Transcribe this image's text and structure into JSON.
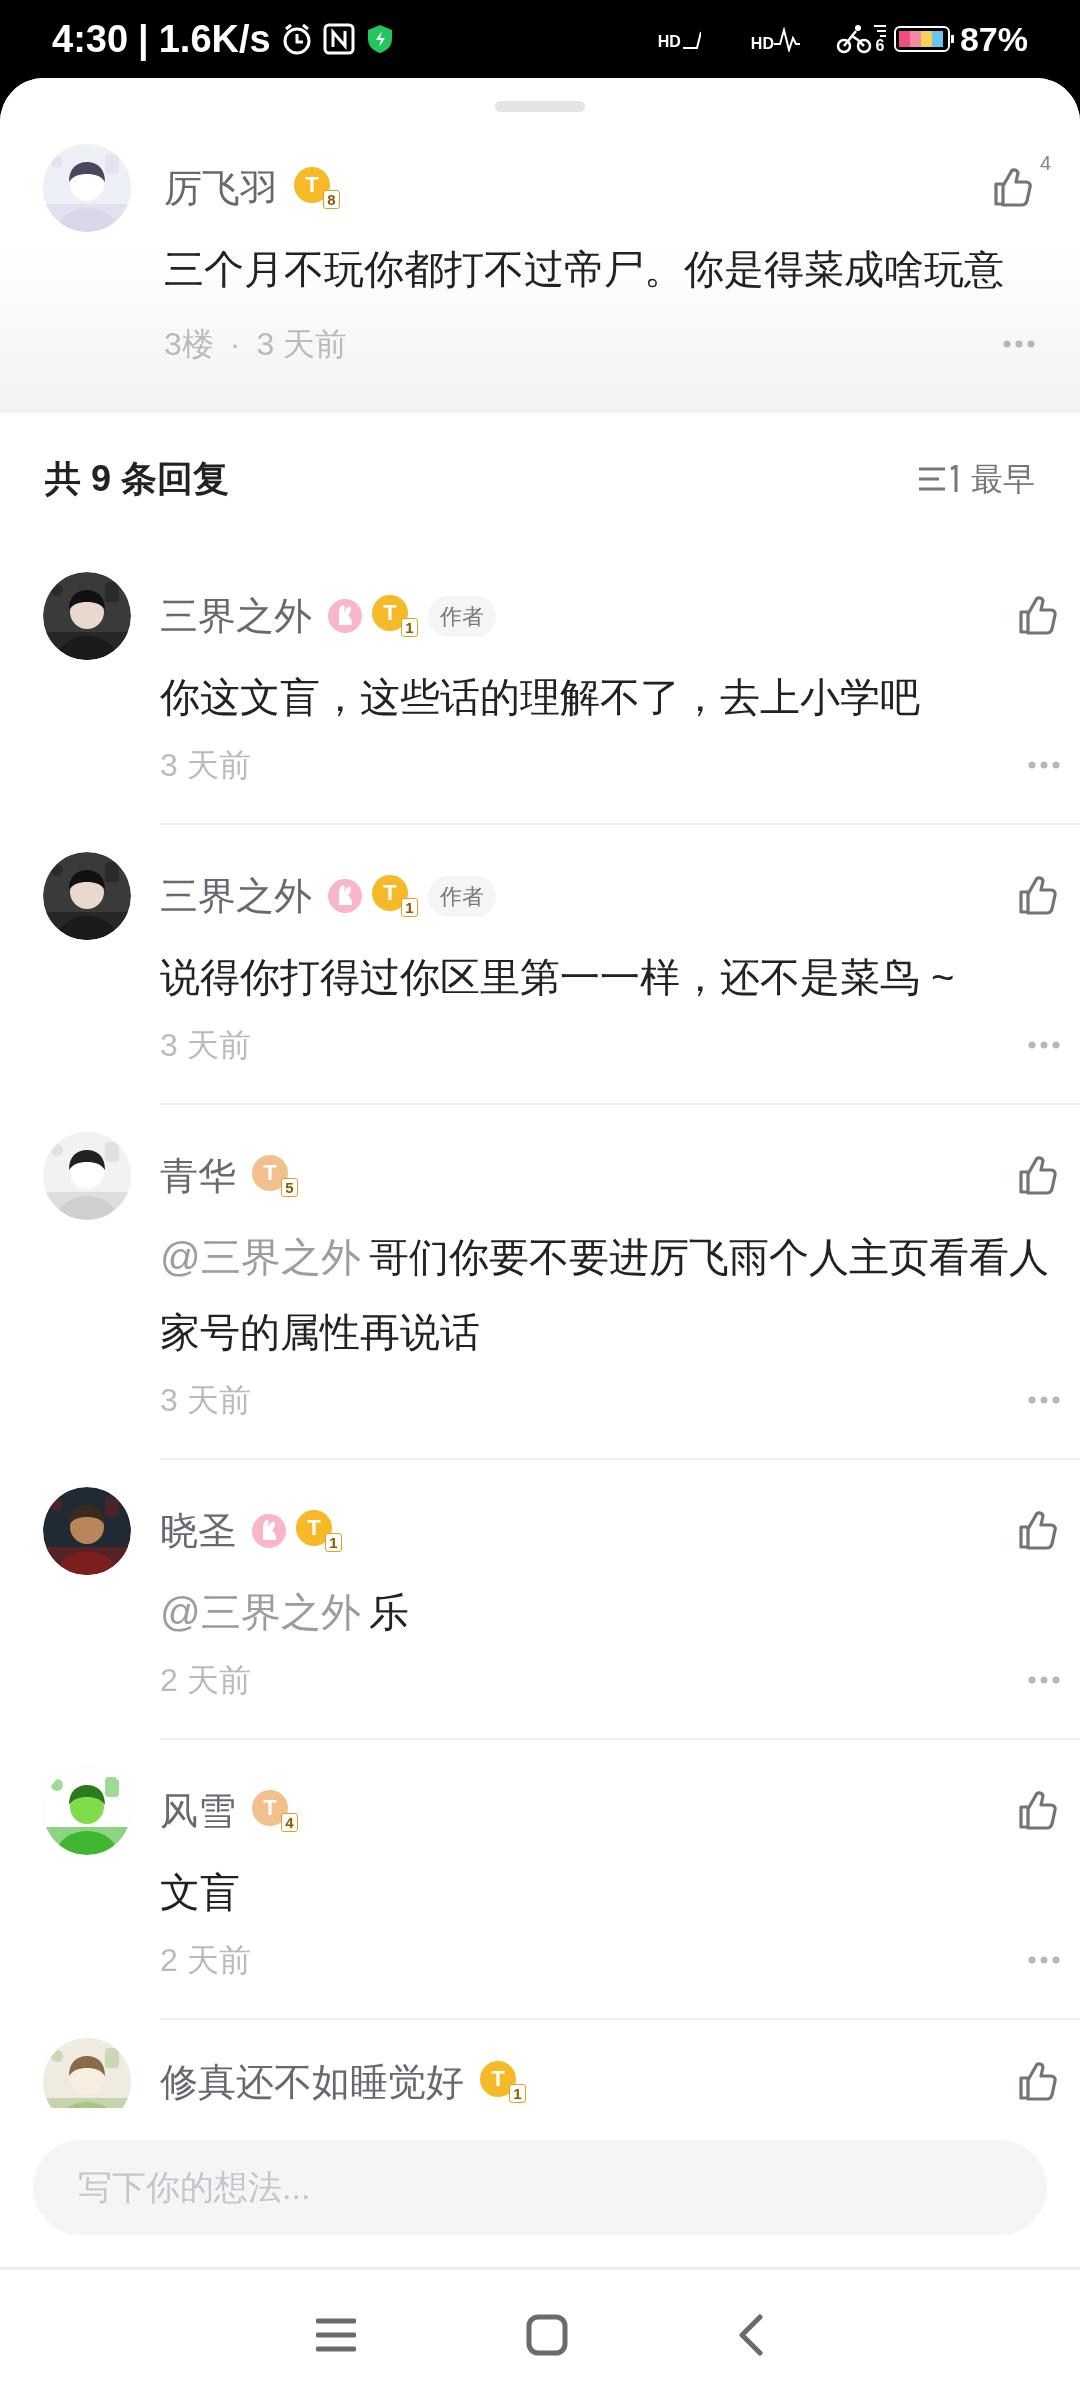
{
  "status_bar": {
    "time": "4:30",
    "separator": "|",
    "speed": "1.6K/s",
    "hd_labels": [
      "HD",
      "HD"
    ],
    "sport_count": "6",
    "battery": "87%"
  },
  "main_comment": {
    "name": "厉飞羽",
    "badges": [
      {
        "kind": "level",
        "letter": "T",
        "level": "8",
        "color": "#f6b928"
      }
    ],
    "likes": "4",
    "text": "三个月不玩你都打不过帝尸。你是得菜成啥玩意",
    "floor": "3楼",
    "dot": "·",
    "time": "3 天前"
  },
  "replies_header": {
    "title": "共 9 条回复",
    "sort": "最早"
  },
  "replies": [
    {
      "name": "三界之外",
      "badges": [
        {
          "kind": "anniversary"
        },
        {
          "kind": "level",
          "letter": "T",
          "level": "1",
          "color": "#f6b928"
        },
        {
          "kind": "author",
          "label": "作者"
        }
      ],
      "text": "你这文盲，这些话的理解不了，去上小学吧",
      "time": "3 天前"
    },
    {
      "name": "三界之外",
      "badges": [
        {
          "kind": "anniversary"
        },
        {
          "kind": "level",
          "letter": "T",
          "level": "1",
          "color": "#f6b928"
        },
        {
          "kind": "author",
          "label": "作者"
        }
      ],
      "text": "说得你打得过你区里第一一样，还不是菜鸟 ~",
      "time": "3 天前"
    },
    {
      "name": "青华",
      "badges": [
        {
          "kind": "level",
          "letter": "T",
          "level": "5",
          "color": "#f2c08c"
        }
      ],
      "mention": "@三界之外",
      "text": "哥们你要不要进厉飞雨个人主页看看人家号的属性再说话",
      "time": "3 天前"
    },
    {
      "name": "晓圣",
      "badges": [
        {
          "kind": "anniversary"
        },
        {
          "kind": "level",
          "letter": "T",
          "level": "1",
          "color": "#f6b928"
        }
      ],
      "mention": "@三界之外",
      "text": "乐",
      "time": "2 天前"
    },
    {
      "name": "风雪",
      "badges": [
        {
          "kind": "level",
          "letter": "T",
          "level": "4",
          "color": "#f2c08c"
        }
      ],
      "text": "文盲",
      "time": "2 天前"
    },
    {
      "name": "修真还不如睡觉好",
      "badges": [
        {
          "kind": "level",
          "letter": "T",
          "level": "1",
          "color": "#f6b928"
        }
      ]
    }
  ],
  "input": {
    "placeholder": "写下你的想法..."
  }
}
